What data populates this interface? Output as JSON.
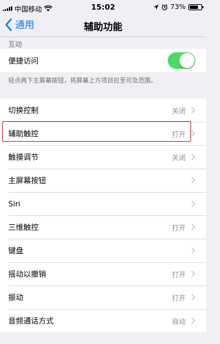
{
  "status_bar": {
    "carrier": "中国移动",
    "time": "15:02",
    "battery": "73%",
    "battery_level": 0.73
  },
  "nav": {
    "back_label": "通用",
    "title": "辅助功能"
  },
  "section": {
    "header": "互动",
    "shortcut_label": "便捷访问",
    "shortcut_on": true,
    "note": "轻点两下主屏幕按钮，将屏幕上方项目拉至可及范围。"
  },
  "rows": [
    {
      "label": "切换控制",
      "value": "关闭"
    },
    {
      "label": "辅助触控",
      "value": "打开"
    },
    {
      "label": "触摸调节",
      "value": "关闭"
    },
    {
      "label": "主屏幕按钮",
      "value": ""
    },
    {
      "label": "Siri",
      "value": ""
    },
    {
      "label": "三维触控",
      "value": "打开"
    },
    {
      "label": "键盘",
      "value": ""
    },
    {
      "label": "摇动以撤销",
      "value": "打开"
    },
    {
      "label": "振动",
      "value": "打开"
    },
    {
      "label": "音频通话方式",
      "value": "自动"
    }
  ],
  "colors": {
    "accent": "#0a7aff",
    "toggle_on": "#4cd964",
    "highlight": "#d62e2e"
  }
}
